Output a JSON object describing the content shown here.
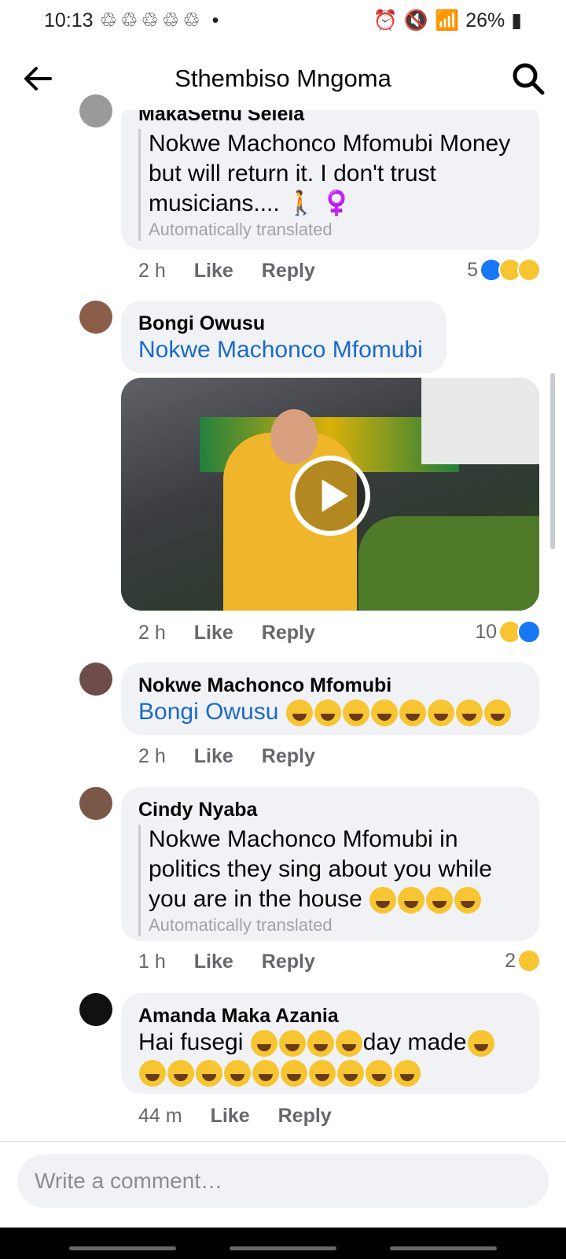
{
  "status_bar": {
    "time": "10:13",
    "battery": "26%"
  },
  "header": {
    "title": "Sthembiso Mngoma"
  },
  "comments": [
    {
      "author": "MakaSethu Selela",
      "text": "Nokwe Machonco Mfomubi Money but will return it. I don't trust musicians.... 🚶 ♀️",
      "line1": "Nokwe Machonco Mfomubi Money",
      "line2": "but will return it. I don't trust",
      "line3": "musicians.... 🚶 ♀️",
      "translated": "Automatically translated",
      "time": "2 h",
      "like": "Like",
      "reply": "Reply",
      "reactions": "5"
    },
    {
      "author": "Bongi Owusu",
      "mention": "Nokwe Machonco Mfomubi",
      "time": "2 h",
      "like": "Like",
      "reply": "Reply",
      "reactions": "10"
    },
    {
      "author": "Nokwe Machonco Mfomubi",
      "mention": "Bongi Owusu",
      "time": "2 h",
      "like": "Like",
      "reply": "Reply"
    },
    {
      "author": "Cindy Nyaba",
      "line1": "Nokwe Machonco Mfomubi in",
      "line2": "politics they sing about you while",
      "line3": "you are in the house",
      "translated": "Automatically translated",
      "time": "1 h",
      "like": "Like",
      "reply": "Reply",
      "reactions": "2"
    },
    {
      "author": "Amanda Maka Azania",
      "line1a": "Hai fusegi",
      "line1b": "day made",
      "time": "44 m",
      "like": "Like",
      "reply": "Reply"
    }
  ],
  "composer": {
    "placeholder": "Write a comment…"
  },
  "colors": {
    "link": "#1b6ac9",
    "bubble": "#f0f2f5",
    "like_blue": "#1877f2"
  }
}
